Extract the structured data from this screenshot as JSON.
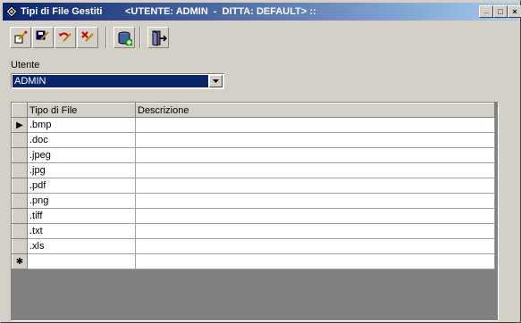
{
  "window": {
    "title": "Tipi di File Gestiti",
    "context": "<UTENTE: ADMIN  -  DITTA: DEFAULT> ::",
    "controls": [
      "_",
      "□",
      "×"
    ]
  },
  "toolbar": {
    "buttons": [
      {
        "icon": "new-record-icon"
      },
      {
        "icon": "save-icon"
      },
      {
        "icon": "undo-icon"
      },
      {
        "icon": "delete-icon"
      },
      {
        "icon": "database-add-icon"
      },
      {
        "icon": "exit-door-icon"
      }
    ]
  },
  "utente": {
    "label": "Utente",
    "value": "ADMIN"
  },
  "grid": {
    "columns": [
      "Tipo di File",
      "Descrizione"
    ],
    "rows": [
      {
        "tipo": ".bmp",
        "descrizione": ""
      },
      {
        "tipo": ".doc",
        "descrizione": ""
      },
      {
        "tipo": ".jpeg",
        "descrizione": ""
      },
      {
        "tipo": ".jpg",
        "descrizione": ""
      },
      {
        "tipo": ".pdf",
        "descrizione": ""
      },
      {
        "tipo": ".png",
        "descrizione": ""
      },
      {
        "tipo": ".tiff",
        "descrizione": ""
      },
      {
        "tipo": ".txt",
        "descrizione": ""
      },
      {
        "tipo": ".xls",
        "descrizione": ""
      }
    ],
    "current_row_marker": "▶",
    "new_row_marker": "✱"
  },
  "colors": {
    "titlebar_start": "#0a246a",
    "titlebar_end": "#a6caf0",
    "selection": "#0a246a",
    "face": "#d4d0c8"
  }
}
